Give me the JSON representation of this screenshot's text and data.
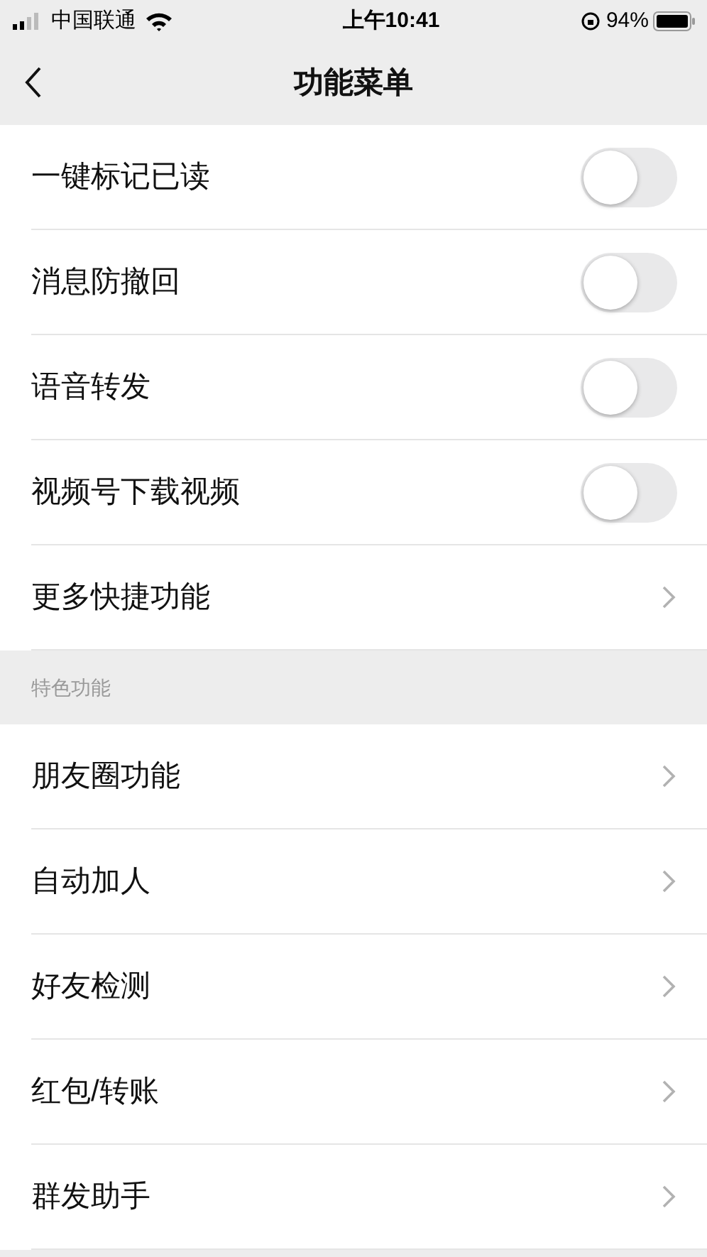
{
  "status_bar": {
    "carrier": "中国联通",
    "time": "上午10:41",
    "battery": "94%"
  },
  "nav": {
    "title": "功能菜单"
  },
  "sections": [
    {
      "items": [
        {
          "kind": "toggle",
          "label": "一键标记已读",
          "on": false
        },
        {
          "kind": "toggle",
          "label": "消息防撤回",
          "on": false
        },
        {
          "kind": "toggle",
          "label": "语音转发",
          "on": false
        },
        {
          "kind": "toggle",
          "label": "视频号下载视频",
          "on": false
        },
        {
          "kind": "link",
          "label": "更多快捷功能"
        }
      ]
    },
    {
      "header": "特色功能",
      "items": [
        {
          "kind": "link",
          "label": "朋友圈功能"
        },
        {
          "kind": "link",
          "label": "自动加人"
        },
        {
          "kind": "link",
          "label": "好友检测"
        },
        {
          "kind": "link",
          "label": "红包/转账"
        },
        {
          "kind": "link",
          "label": "群发助手"
        }
      ]
    }
  ]
}
